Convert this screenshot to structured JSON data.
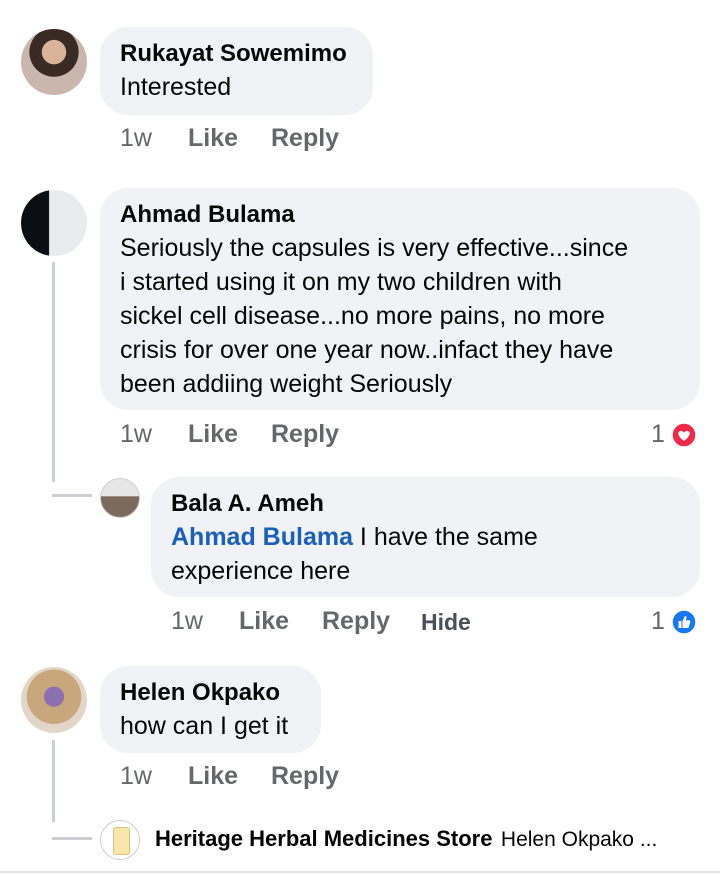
{
  "comments": [
    {
      "author": "Rukayat Sowemimo",
      "text": "Interested",
      "time": "1w",
      "like": "Like",
      "reply": "Reply"
    },
    {
      "author": "Ahmad Bulama",
      "text_lines": [
        "Seriously the capsules is very effective...since",
        "i started using it on my two children with",
        "sickel cell disease...no more pains, no more",
        "crisis for over one year now..infact they have",
        "been addiing weight Seriously"
      ],
      "time": "1w",
      "like": "Like",
      "reply": "Reply",
      "reaction_count": "1",
      "reaction_icon": "heart-reaction-icon",
      "reaction_color": "#f02849"
    },
    {
      "author": "Bala A. Ameh",
      "mention": "Ahmad Bulama",
      "text_line1": " I have the same",
      "text_line2": "experience here",
      "time": "1w",
      "like": "Like",
      "reply": "Reply",
      "hide": "Hide",
      "reaction_count": "1",
      "reaction_icon": "like-reaction-icon",
      "reaction_color": "#1877f2"
    },
    {
      "author": "Helen Okpako",
      "text": "how can I get it",
      "time": "1w",
      "like": "Like",
      "reply": "Reply"
    },
    {
      "author": "Heritage Herbal Medicines Store",
      "preview": "Helen Okpako ..."
    }
  ],
  "colors": {
    "bubble": "#f0f2f5",
    "mention": "#1b5fb8",
    "meta": "#65676b"
  }
}
